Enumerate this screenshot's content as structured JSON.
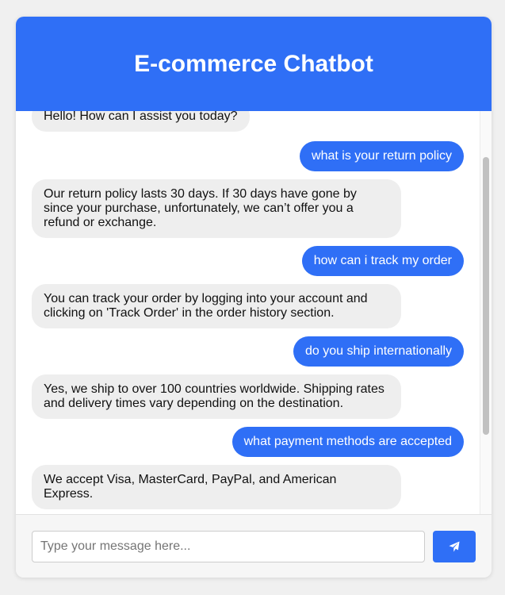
{
  "header": {
    "title": "E-commerce Chatbot"
  },
  "messages": [
    {
      "sender": "bot",
      "text": "Hello! How can I assist you today?"
    },
    {
      "sender": "user",
      "text": "what is your return policy"
    },
    {
      "sender": "bot",
      "text": "Our return policy lasts 30 days. If 30 days have gone by since your purchase, unfortunately, we can’t offer you a refund or exchange."
    },
    {
      "sender": "user",
      "text": "how can i track my order"
    },
    {
      "sender": "bot",
      "text": "You can track your order by logging into your account and clicking on 'Track Order' in the order history section."
    },
    {
      "sender": "user",
      "text": "do you ship internationally"
    },
    {
      "sender": "bot",
      "text": "Yes, we ship to over 100 countries worldwide. Shipping rates and delivery times vary depending on the destination."
    },
    {
      "sender": "user",
      "text": "what payment methods are accepted"
    },
    {
      "sender": "bot",
      "text": "We accept Visa, MasterCard, PayPal, and American Express."
    }
  ],
  "input": {
    "placeholder": "Type your message here...",
    "value": ""
  },
  "send_button": {
    "icon": "paper-plane-icon"
  },
  "colors": {
    "accent": "#2f6ff6",
    "bot_bubble": "#eeeeee",
    "background": "#f0f0f0"
  }
}
